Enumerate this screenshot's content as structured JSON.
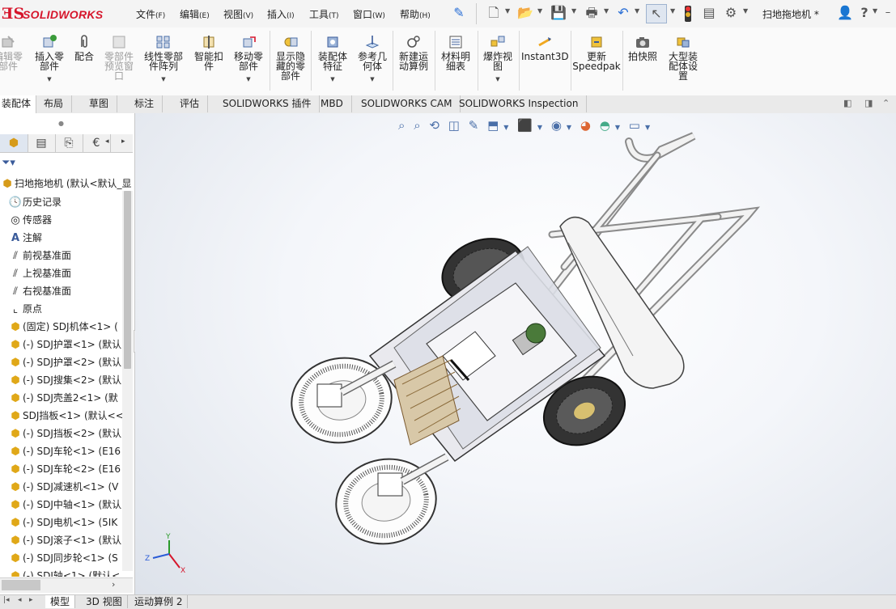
{
  "app": {
    "brand": "SOLIDWORKS",
    "document_title": "扫地拖地机 *"
  },
  "menu": [
    {
      "label": "文件",
      "acc": "(F)"
    },
    {
      "label": "编辑",
      "acc": "(E)"
    },
    {
      "label": "视图",
      "acc": "(V)"
    },
    {
      "label": "插入",
      "acc": "(I)"
    },
    {
      "label": "工具",
      "acc": "(T)"
    },
    {
      "label": "窗口",
      "acc": "(W)"
    },
    {
      "label": "帮助",
      "acc": "(H)"
    }
  ],
  "ribbon": [
    {
      "label": "编辑零\n部件",
      "disabled": true
    },
    {
      "label": "插入零\n部件",
      "disabled": false
    },
    {
      "label": "配合",
      "disabled": false
    },
    {
      "label": "零部件\n预览窗\n口",
      "disabled": true
    },
    {
      "label": "线性零部\n件阵列",
      "disabled": false
    },
    {
      "label": "智能扣\n件",
      "disabled": false
    },
    {
      "label": "移动零\n部件",
      "disabled": false
    },
    {
      "label": "显示隐\n藏的零\n部件",
      "disabled": false
    },
    {
      "label": "装配体\n特征",
      "disabled": false
    },
    {
      "label": "参考几\n何体",
      "disabled": false
    },
    {
      "label": "新建运\n动算例",
      "disabled": false
    },
    {
      "label": "材料明\n细表",
      "disabled": false
    },
    {
      "label": "爆炸视\n图",
      "disabled": false
    },
    {
      "label": "Instant3D",
      "disabled": false
    },
    {
      "label": "更新\nSpeedpak",
      "disabled": false
    },
    {
      "label": "拍快照",
      "disabled": false
    },
    {
      "label": "大型装\n配体设\n置",
      "disabled": false
    }
  ],
  "tabs": [
    "装配体",
    "布局",
    "草图",
    "标注",
    "评估",
    "SOLIDWORKS 插件",
    "MBD",
    "SOLIDWORKS CAM",
    "SOLIDWORKS Inspection"
  ],
  "tree": {
    "root": "扫地拖地机 (默认<默认_显",
    "items": [
      "历史记录",
      "传感器",
      "注解",
      "前视基准面",
      "上视基准面",
      "右视基准面",
      "原点",
      "(固定) SDJ机体<1> (",
      "(-) SDJ护罩<1> (默认",
      "(-) SDJ护罩<2> (默认",
      "(-) SDJ搜集<2> (默认",
      "(-) SDJ壳盖2<1> (默",
      "SDJ挡板<1> (默认<<",
      "(-) SDJ挡板<2> (默认",
      "(-) SDJ车轮<1> (E16",
      "(-) SDJ车轮<2> (E16",
      "(-) SDJ减速机<1> (V",
      "(-) SDJ中轴<1> (默认",
      "(-) SDJ电机<1> (5IK",
      "(-) SDJ滚子<1> (默认",
      "(-) SDJ同步轮<1> (S",
      "(-) SDJ轴<1> (默认<"
    ]
  },
  "triad": {
    "x": "X",
    "y": "Y",
    "z": "Z"
  },
  "bottom_tabs": [
    "模型",
    "3D 视图",
    "运动算例 2"
  ],
  "colors": {
    "brand": "#d6162c",
    "accent": "#4a6fa8"
  }
}
